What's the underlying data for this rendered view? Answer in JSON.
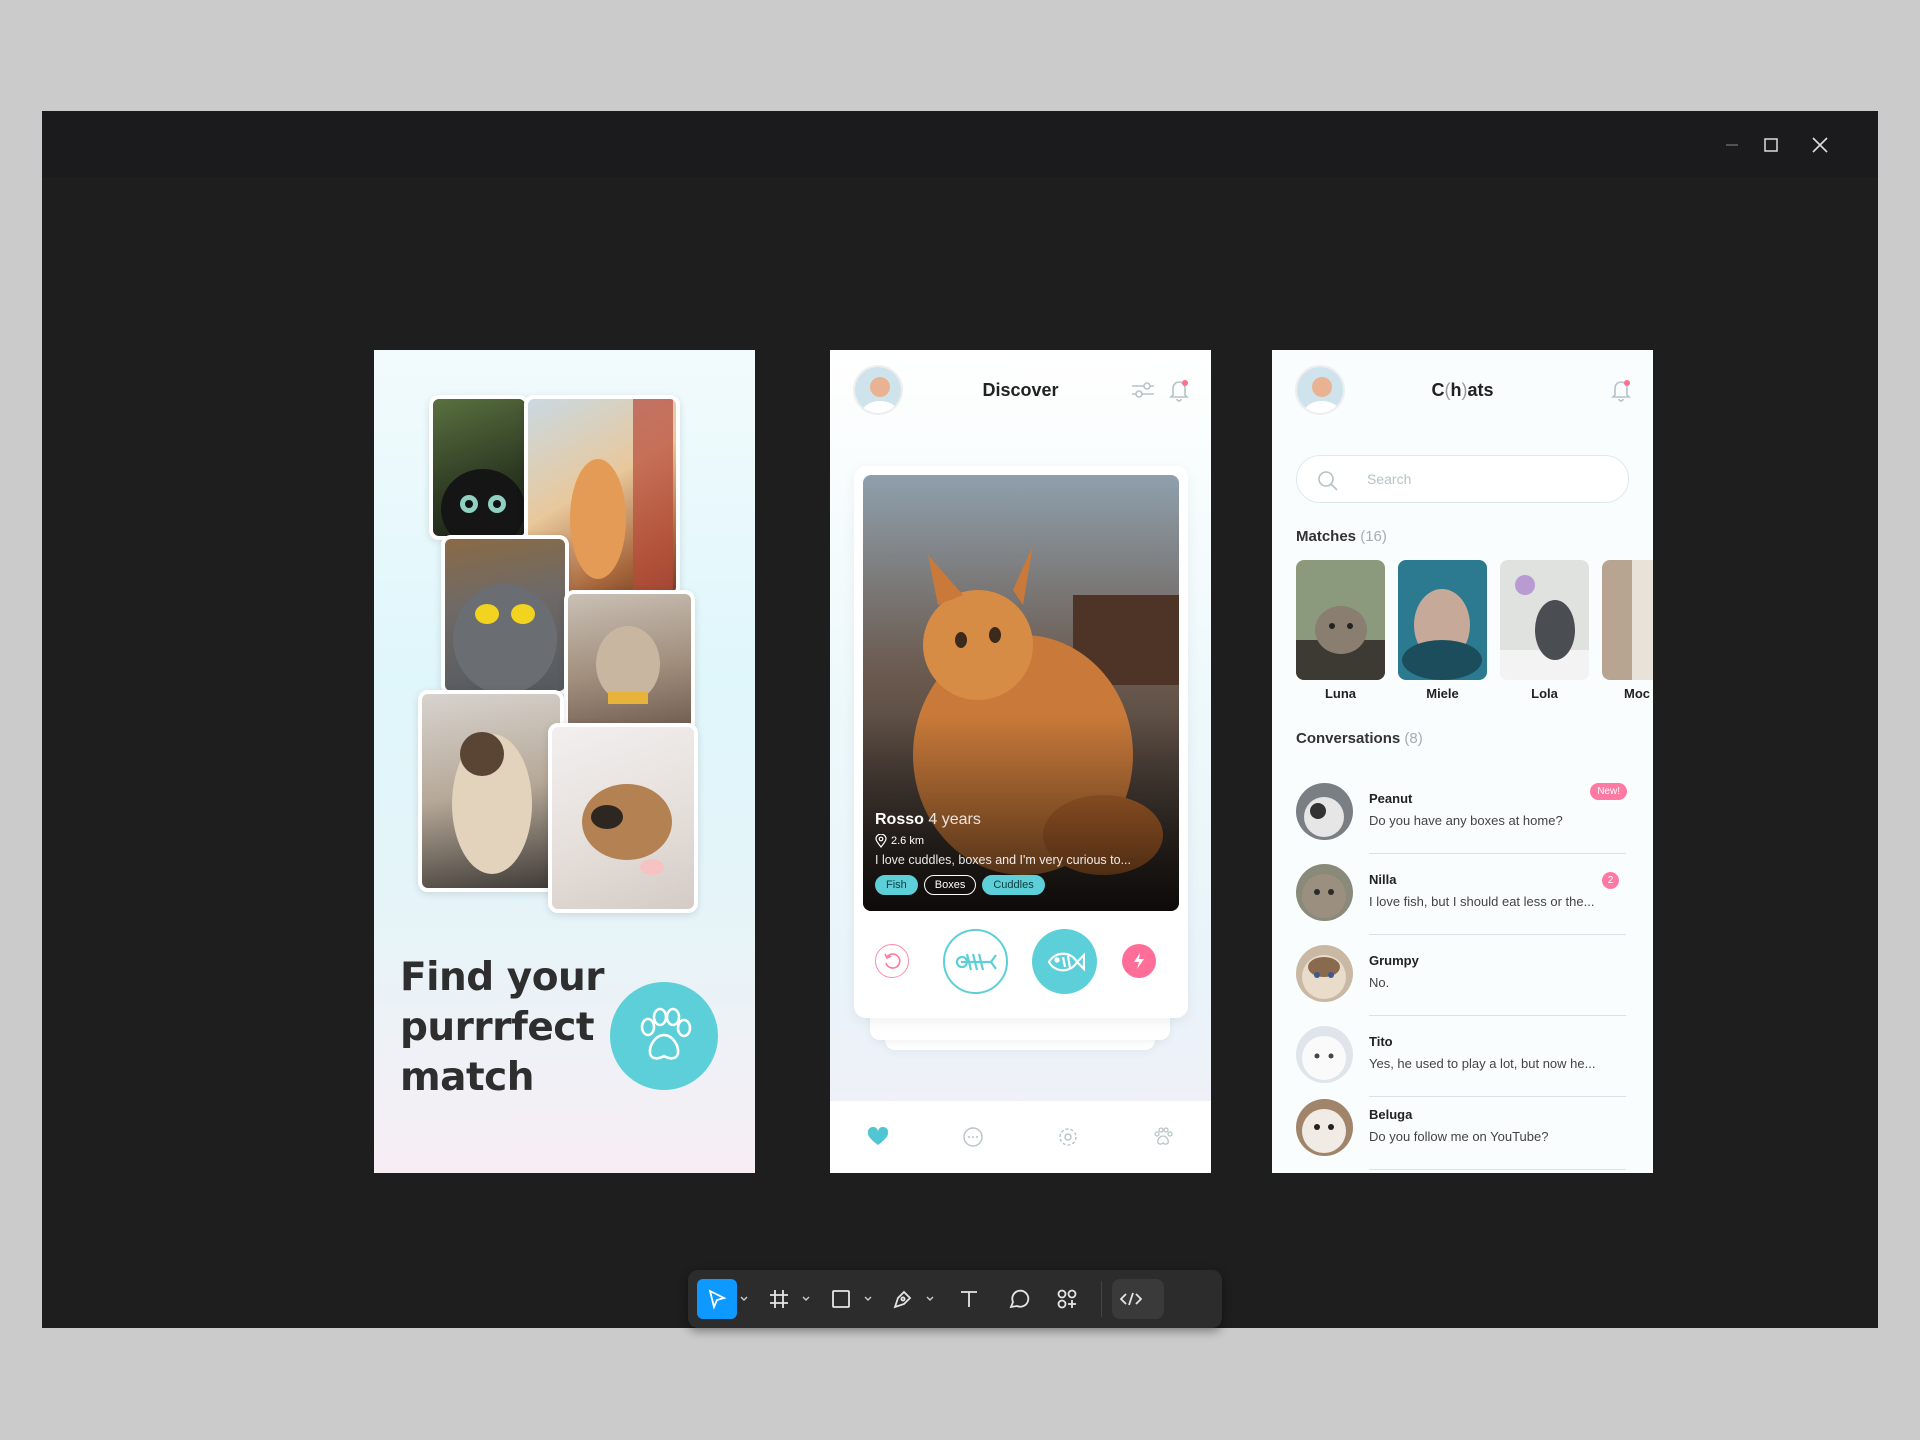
{
  "window": {
    "title": ""
  },
  "screen1": {
    "headline_lines": [
      "Find your",
      "purrrfect",
      "match"
    ],
    "accent": "#5ccfd8"
  },
  "screen2": {
    "title": "Discover",
    "cat": {
      "name": "Rosso",
      "age": "4 years",
      "distance": "2.6 km",
      "bio": "I love cuddles, boxes and I'm very curious to...",
      "tags": [
        "Fish",
        "Boxes",
        "Cuddles"
      ]
    },
    "actions": [
      "undo-icon",
      "fishbone-icon",
      "fish-icon",
      "bolt-icon"
    ],
    "tabs": [
      "heart-icon",
      "chat-icon",
      "gear-icon",
      "paw-icon"
    ]
  },
  "screen3": {
    "title_prefix": "C",
    "title_mid": "h",
    "title_suffix": "ats",
    "search_placeholder": "Search",
    "matches_label": "Matches",
    "matches_count": "(16)",
    "matches": [
      "Luna",
      "Miele",
      "Lola",
      "Moc"
    ],
    "conversations_label": "Conversations",
    "conversations_count": "(8)",
    "conversations": [
      {
        "name": "Peanut",
        "message": "Do you have any boxes at home?",
        "badge": "New!"
      },
      {
        "name": "Nilla",
        "message": "I love fish, but I should eat less or the...",
        "count": "2"
      },
      {
        "name": "Grumpy",
        "message": "No."
      },
      {
        "name": "Tito",
        "message": "Yes, he used to play a lot, but now he..."
      },
      {
        "name": "Beluga",
        "message": "Do you follow me on YouTube?"
      }
    ]
  },
  "toolbar": {
    "tools": [
      "move-tool",
      "frame-tool",
      "shape-tool",
      "pen-tool",
      "text-tool",
      "comment-tool",
      "components-tool",
      "dev-mode-toggle"
    ],
    "active": "move-tool",
    "active_color": "#0d99ff"
  }
}
